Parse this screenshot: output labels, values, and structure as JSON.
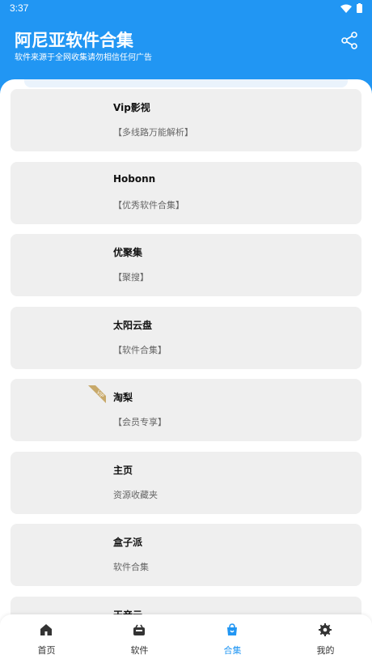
{
  "status": {
    "time": "3:37"
  },
  "header": {
    "title": "阿尼亚软件合集",
    "subtitle": "软件来源于全网收集请勿相信任何广告",
    "share_icon": "share-icon"
  },
  "colors": {
    "primary": "#2196f3",
    "card_bg": "#efefef",
    "vip_badge": "#c8a96a"
  },
  "items": [
    {
      "title": "Vip影视",
      "desc": "【多线路万能解析】",
      "vip": false
    },
    {
      "title": "Hobonn",
      "desc": "【优秀软件合集】",
      "vip": false
    },
    {
      "title": "优聚集",
      "desc": "【聚搜】",
      "vip": false
    },
    {
      "title": "太阳云盘",
      "desc": "【软件合集】",
      "vip": false
    },
    {
      "title": "淘梨",
      "desc": "【会员专享】",
      "vip": true
    },
    {
      "title": "主页",
      "desc": "资源收藏夹",
      "vip": false
    },
    {
      "title": "盒子派",
      "desc": "软件合集",
      "vip": false
    },
    {
      "title": "天音云",
      "desc": "",
      "vip": false
    }
  ],
  "tabs": [
    {
      "label": "首页",
      "icon": "home-icon",
      "active": false
    },
    {
      "label": "软件",
      "icon": "software-icon",
      "active": false
    },
    {
      "label": "合集",
      "icon": "collection-bag-icon",
      "active": true
    },
    {
      "label": "我的",
      "icon": "profile-gear-icon",
      "active": false
    }
  ]
}
